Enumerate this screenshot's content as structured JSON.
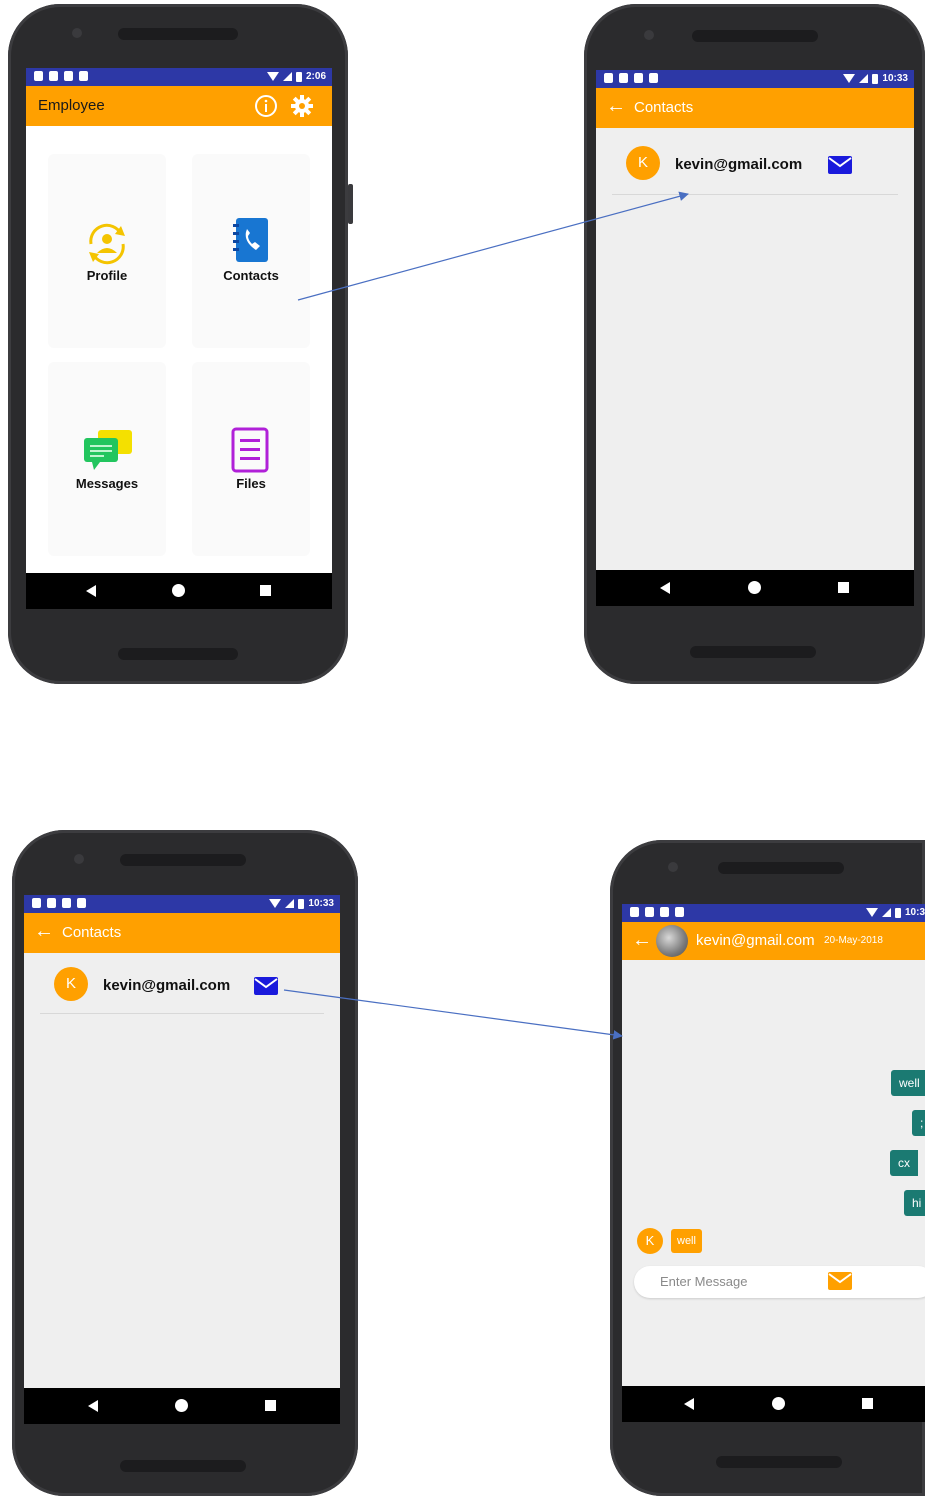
{
  "colors": {
    "accent": "#ffa000",
    "statusbar": "#2d38a6",
    "sent_bubble": "#1b7a72",
    "mail_icon": "#1a1adc",
    "arrow": "#4a6fc2"
  },
  "screen1": {
    "status_time": "2:06",
    "appbar_title": "Employee",
    "appbar_icons": [
      "info-icon",
      "gear-icon"
    ],
    "tiles": [
      {
        "label": "Profile",
        "icon": "profile-sync-icon"
      },
      {
        "label": "Contacts",
        "icon": "contacts-book-icon"
      },
      {
        "label": "Messages",
        "icon": "chat-bubbles-icon"
      },
      {
        "label": "Files",
        "icon": "document-icon"
      }
    ]
  },
  "screen2": {
    "status_time": "10:33",
    "appbar_title": "Contacts",
    "contact": {
      "initial": "K",
      "email": "kevin@gmail.com"
    }
  },
  "screen3": {
    "status_time": "10:33",
    "appbar_title": "Contacts",
    "contact": {
      "initial": "K",
      "email": "kevin@gmail.com"
    }
  },
  "screen4": {
    "status_time": "10:3",
    "appbar_title": "kevin@gmail.com",
    "appbar_date": "20-May-2018",
    "sent_messages": [
      "well",
      ";",
      "cx",
      "hi"
    ],
    "received": {
      "initial": "K",
      "text": "well"
    },
    "input_placeholder": "Enter Message"
  }
}
